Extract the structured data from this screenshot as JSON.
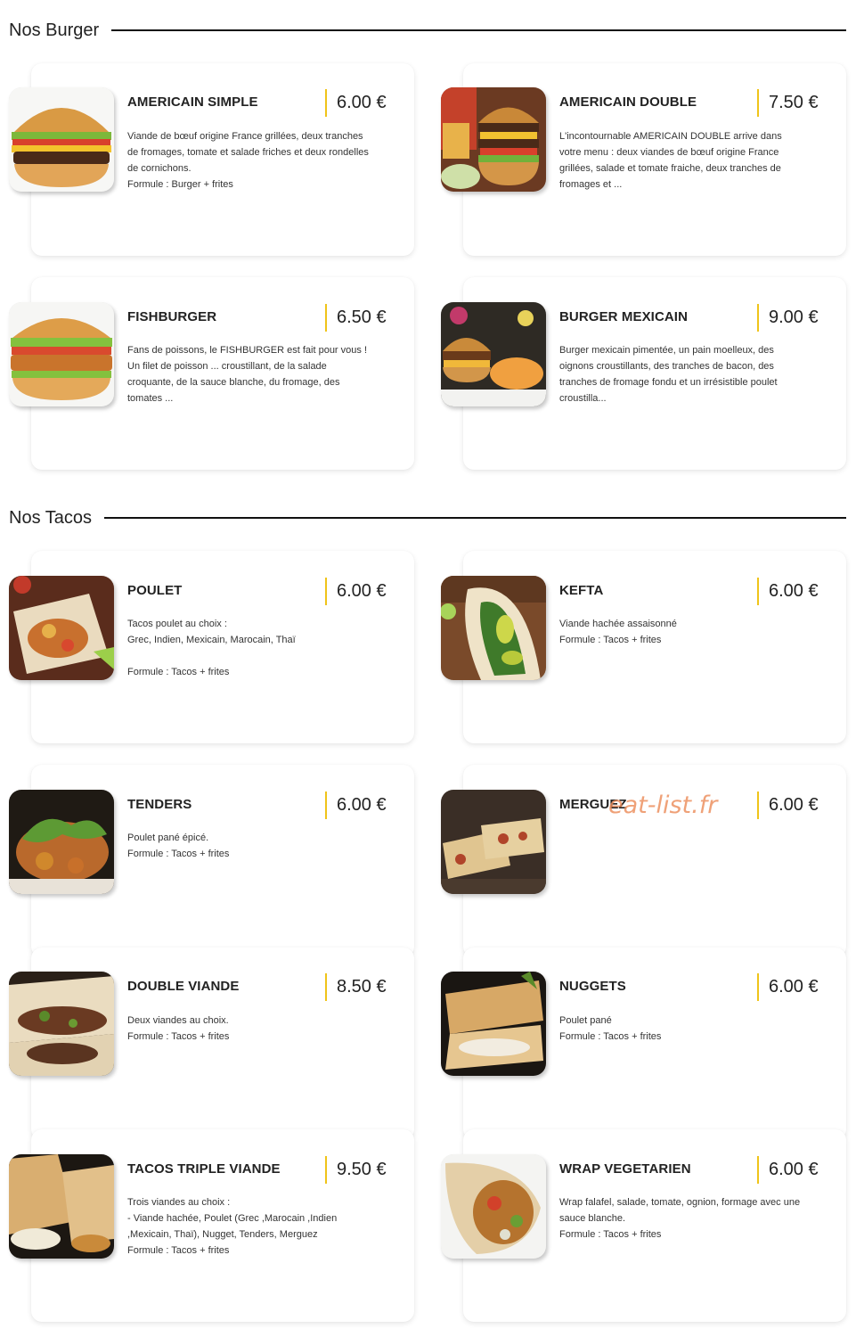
{
  "sections": [
    {
      "title": "Nos Burger"
    },
    {
      "title": "Nos Tacos"
    }
  ],
  "items": [
    {
      "name": "AMERICAIN SIMPLE",
      "price": "6.00 €",
      "desc": [
        "Viande de bœuf origine France grillées, deux tranches",
        "de fromages, tomate et salade friches et deux rondelles",
        "de cornichons.",
        "Formule : Burger + frites"
      ]
    },
    {
      "name": "AMERICAIN DOUBLE",
      "price": "7.50 €",
      "desc": [
        "L'incontournable AMERICAIN DOUBLE arrive dans",
        "votre menu : deux viandes de bœuf origine France",
        "grillées, salade et tomate fraiche, deux tranches de",
        "fromages et ..."
      ]
    },
    {
      "name": "FISHBURGER",
      "price": "6.50 €",
      "desc": [
        "Fans de poissons, le FISHBURGER est fait pour vous !",
        "Un filet de poisson ... croustillant, de la salade",
        "croquante, de la sauce blanche, du fromage, des",
        "tomates ..."
      ]
    },
    {
      "name": "BURGER MEXICAIN",
      "price": "9.00 €",
      "desc": [
        "Burger mexicain pimentée, un pain moelleux, des",
        "oignons croustillants, des tranches de bacon, des",
        "tranches de fromage fondu et un irrésistible poulet",
        "croustilla..."
      ]
    },
    {
      "name": "POULET",
      "price": "6.00 €",
      "desc": [
        "Tacos poulet au choix :",
        "Grec, Indien, Mexicain, Marocain, Thaï",
        "",
        "Formule : Tacos + frites"
      ]
    },
    {
      "name": "KEFTA",
      "price": "6.00 €",
      "desc": [
        "Viande hachée assaisonné",
        "Formule : Tacos + frites"
      ]
    },
    {
      "name": "TENDERS",
      "price": "6.00 €",
      "desc": [
        "Poulet pané épicé.",
        "Formule : Tacos + frites"
      ]
    },
    {
      "name": "MERGUEZ",
      "price": "6.00 €",
      "desc": []
    },
    {
      "name": "DOUBLE VIANDE",
      "price": "8.50 €",
      "desc": [
        "Deux viandes au choix.",
        "Formule : Tacos + frites"
      ]
    },
    {
      "name": "NUGGETS",
      "price": "6.00 €",
      "desc": [
        "Poulet pané",
        "Formule : Tacos + frites"
      ]
    },
    {
      "name": "TACOS TRIPLE VIANDE",
      "price": "9.50 €",
      "desc": [
        "Trois viandes au choix :",
        "- Viande hachée, Poulet (Grec ,Marocain ,Indien",
        ",Mexicain, Thaï), Nugget, Tenders, Merguez",
        "Formule : Tacos + frites"
      ]
    },
    {
      "name": "WRAP VEGETARIEN",
      "price": "6.00 €",
      "desc": [
        "Wrap falafel, salade, tomate, ognion, formage avec une",
        "sauce blanche.",
        "Formule : Tacos + frites"
      ]
    }
  ],
  "watermark": "eat-list.fr",
  "colors": {
    "price_accent": "#f0c419",
    "watermark": "#ec8c5a",
    "rule": "#111111"
  }
}
